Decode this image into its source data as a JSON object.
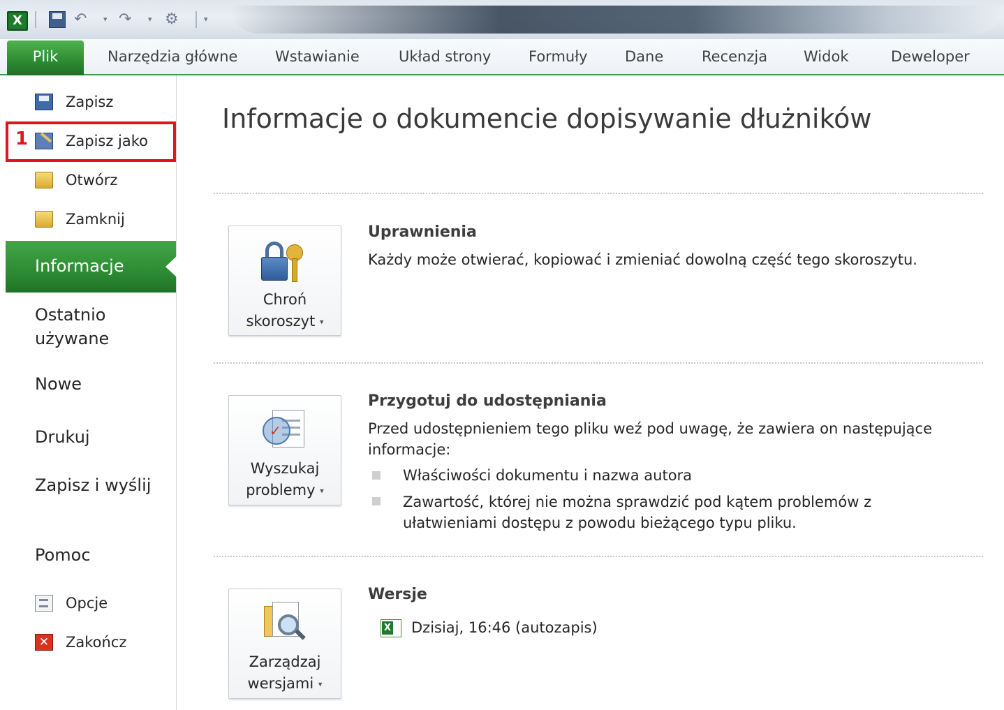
{
  "quick_access": {
    "app_icon_letter": "X",
    "icons": [
      "excel-app-icon",
      "save-icon",
      "undo-icon",
      "redo-icon",
      "customize-icon"
    ]
  },
  "ribbon": {
    "tabs": [
      "Plik",
      "Narzędzia główne",
      "Wstawianie",
      "Układ strony",
      "Formuły",
      "Dane",
      "Recenzja",
      "Widok",
      "Deweloper"
    ],
    "active_tab": "Plik"
  },
  "backstage_nav": {
    "commands": [
      {
        "label": "Zapisz",
        "icon": "save-icon"
      },
      {
        "label": "Zapisz jako",
        "icon": "save-as-icon"
      },
      {
        "label": "Otwórz",
        "icon": "open-folder-icon"
      },
      {
        "label": "Zamknij",
        "icon": "close-folder-icon"
      }
    ],
    "highlight_number": "1",
    "selected": "Informacje",
    "sections": [
      "Ostatnio używane",
      "Nowe",
      "Drukuj",
      "Zapisz i wyślij",
      "Pomoc"
    ],
    "bottom_commands": [
      {
        "label": "Opcje",
        "icon": "options-icon"
      },
      {
        "label": "Zakończ",
        "icon": "exit-icon"
      }
    ],
    "exit_icon_glyph": "✕"
  },
  "main": {
    "title": "Informacje o dokumencie dopisywanie dłużników",
    "protect": {
      "button_line1": "Chroń",
      "button_line2": "skoroszyt",
      "heading": "Uprawnienia",
      "text": "Każdy może otwierać, kopiować i zmieniać dowolną część tego skoroszytu."
    },
    "prepare": {
      "button_line1": "Wyszukaj",
      "button_line2": "problemy",
      "heading": "Przygotuj do udostępniania",
      "text": "Przed udostępnieniem tego pliku weź pod uwagę, że zawiera on następujące informacje:",
      "bullets": [
        "Właściwości dokumentu i nazwa autora",
        "Zawartość, której nie można sprawdzić pod kątem problemów z ułatwieniami dostępu z powodu bieżącego typu pliku."
      ]
    },
    "versions": {
      "button_line1": "Zarządzaj",
      "button_line2": "wersjami",
      "heading": "Wersje",
      "entry": "Dzisiaj, 16:46 (autozapis)"
    },
    "dropdown_arrow": "▾"
  },
  "colors": {
    "accent_green": "#2f8e35",
    "highlight_red": "#e3141a"
  }
}
